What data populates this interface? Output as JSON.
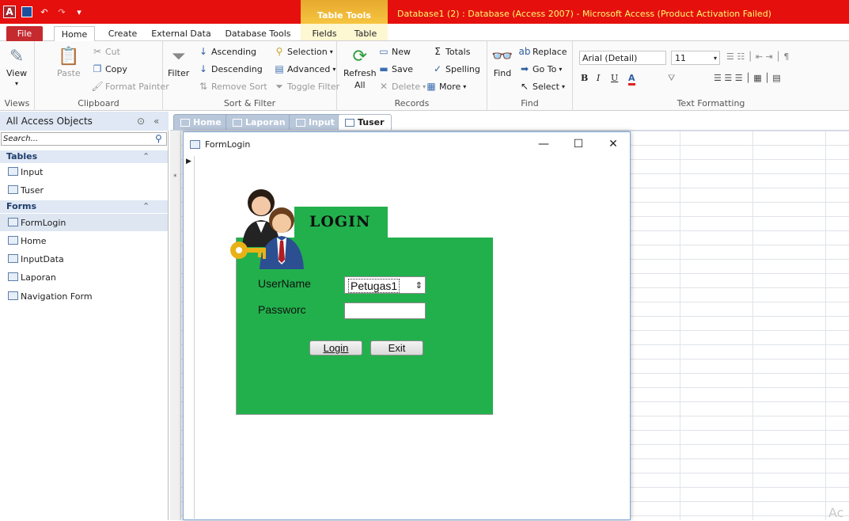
{
  "window": {
    "title": "Database1 (2) : Database (Access 2007) - Microsoft Access (Product Activation Failed)",
    "context_tab": "Table Tools"
  },
  "ribbon_tabs": [
    "File",
    "Home",
    "Create",
    "External Data",
    "Database Tools",
    "Fields",
    "Table"
  ],
  "ribbon": {
    "views": {
      "label": "Views",
      "view": "View"
    },
    "clipboard": {
      "label": "Clipboard",
      "paste": "Paste",
      "cut": "Cut",
      "copy": "Copy",
      "format_painter": "Format Painter"
    },
    "sort_filter": {
      "label": "Sort & Filter",
      "filter": "Filter",
      "ascending": "Ascending",
      "descending": "Descending",
      "remove_sort": "Remove Sort",
      "selection": "Selection",
      "advanced": "Advanced",
      "toggle_filter": "Toggle Filter"
    },
    "records": {
      "label": "Records",
      "refresh": "Refresh",
      "refresh2": "All",
      "new": "New",
      "save": "Save",
      "delete": "Delete",
      "totals": "Totals",
      "spelling": "Spelling",
      "more": "More"
    },
    "find": {
      "label": "Find",
      "find": "Find",
      "replace": "Replace",
      "goto": "Go To",
      "select": "Select"
    },
    "text_formatting": {
      "label": "Text Formatting",
      "font": "Arial (Detail)",
      "size": "11"
    }
  },
  "nav": {
    "header": "All Access Objects",
    "search_placeholder": "Search...",
    "sections": [
      {
        "title": "Tables",
        "items": [
          "Input",
          "Tuser"
        ]
      },
      {
        "title": "Forms",
        "items": [
          "FormLogin",
          "Home",
          "InputData",
          "Laporan",
          "Navigation Form"
        ]
      }
    ]
  },
  "doc_tabs": [
    "Home",
    "Laporan",
    "Input",
    "Tuser"
  ],
  "form": {
    "title": "FormLogin",
    "heading": "LOGIN",
    "username_label": "UserName",
    "username_value": "Petugas1",
    "password_label": "Passworc",
    "login_button": "Login",
    "exit_button": "Exit"
  },
  "watermark": "Ac",
  "colors": {
    "title_bar": "#e5100e",
    "form_green": "#22b04c",
    "file_tab": "#c52a2f"
  }
}
